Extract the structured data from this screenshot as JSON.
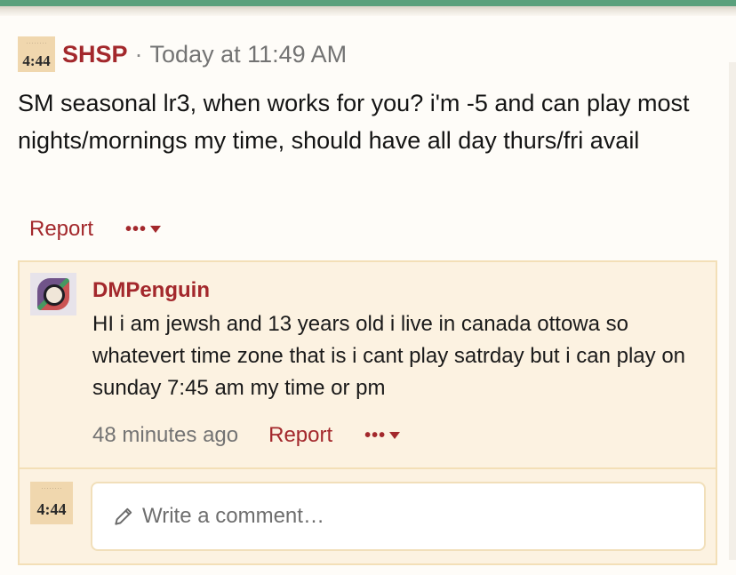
{
  "post": {
    "avatar_text": "4:44",
    "author": "SHSP",
    "separator": "·",
    "timestamp": "Today at 11:49 AM",
    "body": "SM seasonal lr3, when works for you? i'm -5 and can play most nights/mornings my time, should have all day thurs/fri avail",
    "report_label": "Report",
    "more_label": "•••"
  },
  "comments": [
    {
      "author": "DMPenguin",
      "text": "HI i am jewsh and 13 years old i live in canada ottowa so whatevert time zone that is i cant play satrday but i can play on sunday 7:45 am my time or pm",
      "time_ago": "48 minutes ago",
      "report_label": "Report",
      "more_label": "•••"
    }
  ],
  "composer": {
    "avatar_text": "4:44",
    "placeholder": "Write a comment…"
  },
  "colors": {
    "accent": "#a3282c",
    "top_bar": "#5aa07c",
    "comment_bg": "#fcf2e1",
    "comment_border": "#f3dfb7"
  }
}
